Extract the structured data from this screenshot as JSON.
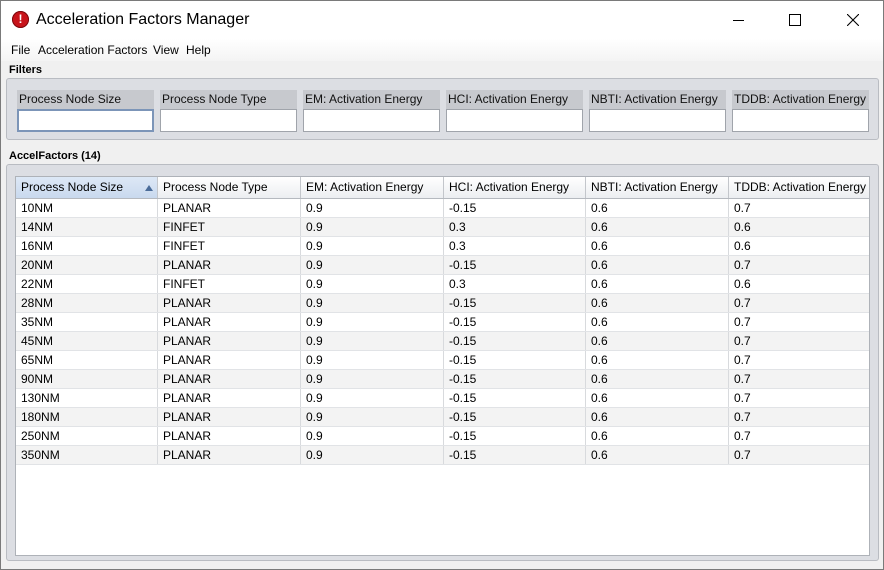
{
  "window": {
    "title": "Acceleration Factors Manager",
    "controls": {
      "minimize": "minimize",
      "maximize": "maximize",
      "close": "close"
    }
  },
  "menu": [
    "File",
    "Acceleration Factors",
    "View",
    "Help"
  ],
  "filters": {
    "title": "Filters",
    "fields": [
      {
        "label": "Process Node Size",
        "value": ""
      },
      {
        "label": "Process Node Type",
        "value": ""
      },
      {
        "label": "EM: Activation Energy",
        "value": ""
      },
      {
        "label": "HCI: Activation Energy",
        "value": ""
      },
      {
        "label": "NBTI: Activation Energy",
        "value": ""
      },
      {
        "label": "TDDB: Activation Energy",
        "value": ""
      }
    ]
  },
  "table": {
    "title": "AccelFactors (14)",
    "sorted_column": 0,
    "sort_direction": "ascending",
    "columns": [
      "Process Node Size",
      "Process Node Type",
      "EM: Activation Energy",
      "HCI: Activation Energy",
      "NBTI: Activation Energy",
      "TDDB: Activation Energy"
    ],
    "rows": [
      [
        "10NM",
        "PLANAR",
        "0.9",
        "-0.15",
        "0.6",
        "0.7"
      ],
      [
        "14NM",
        "FINFET",
        "0.9",
        "0.3",
        "0.6",
        "0.6"
      ],
      [
        "16NM",
        "FINFET",
        "0.9",
        "0.3",
        "0.6",
        "0.6"
      ],
      [
        "20NM",
        "PLANAR",
        "0.9",
        "-0.15",
        "0.6",
        "0.7"
      ],
      [
        "22NM",
        "FINFET",
        "0.9",
        "0.3",
        "0.6",
        "0.6"
      ],
      [
        "28NM",
        "PLANAR",
        "0.9",
        "-0.15",
        "0.6",
        "0.7"
      ],
      [
        "35NM",
        "PLANAR",
        "0.9",
        "-0.15",
        "0.6",
        "0.7"
      ],
      [
        "45NM",
        "PLANAR",
        "0.9",
        "-0.15",
        "0.6",
        "0.7"
      ],
      [
        "65NM",
        "PLANAR",
        "0.9",
        "-0.15",
        "0.6",
        "0.7"
      ],
      [
        "90NM",
        "PLANAR",
        "0.9",
        "-0.15",
        "0.6",
        "0.7"
      ],
      [
        "130NM",
        "PLANAR",
        "0.9",
        "-0.15",
        "0.6",
        "0.7"
      ],
      [
        "180NM",
        "PLANAR",
        "0.9",
        "-0.15",
        "0.6",
        "0.7"
      ],
      [
        "250NM",
        "PLANAR",
        "0.9",
        "-0.15",
        "0.6",
        "0.7"
      ],
      [
        "350NM",
        "PLANAR",
        "0.9",
        "-0.15",
        "0.6",
        "0.7"
      ]
    ]
  },
  "colors": {
    "app_icon": "#c8141b",
    "panel": "#dcdee3",
    "sorted_header": "#c9d9ee"
  }
}
